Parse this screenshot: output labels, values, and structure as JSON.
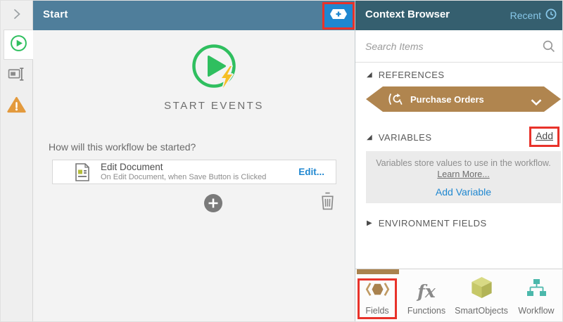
{
  "left_rail": {
    "icons": [
      "expand-panel-chevron",
      "start-play",
      "rename",
      "warnings"
    ]
  },
  "start_panel": {
    "title": "Start",
    "start_events_label": "START EVENTS",
    "question": "How will this workflow be started?",
    "event": {
      "title": "Edit Document",
      "subtitle": "On Edit Document, when Save Button is Clicked",
      "edit_link": "Edit..."
    }
  },
  "context_browser": {
    "title": "Context Browser",
    "recent_label": "Recent",
    "search_placeholder": "Search Items",
    "references": {
      "label": "REFERENCES",
      "item_label": "Purchase Orders"
    },
    "variables": {
      "label": "VARIABLES",
      "add_link": "Add",
      "info_text": "Variables store values to use in the workflow.",
      "learn_more_link": "Learn More...",
      "add_variable_link": "Add Variable"
    },
    "environment_fields": {
      "label": "ENVIRONMENT FIELDS"
    },
    "tabs": [
      {
        "label": "Fields",
        "active": true
      },
      {
        "label": "Functions",
        "active": false
      },
      {
        "label": "SmartObjects",
        "active": false
      },
      {
        "label": "Workflow",
        "active": false
      }
    ]
  },
  "colors": {
    "start_header": "#4f7e9b",
    "context_header": "#355f6f",
    "accent_blue": "#1f87d0",
    "recent_blue": "#87c7e9",
    "reference_bronze": "#b0854f",
    "start_green": "#2fbf5f",
    "bolt_yellow": "#f6bf26",
    "warning_orange": "#e39a3d",
    "smartobject_olive": "#c6c868",
    "workflow_teal": "#4bb8ab",
    "annotation_red": "#e8322a"
  }
}
